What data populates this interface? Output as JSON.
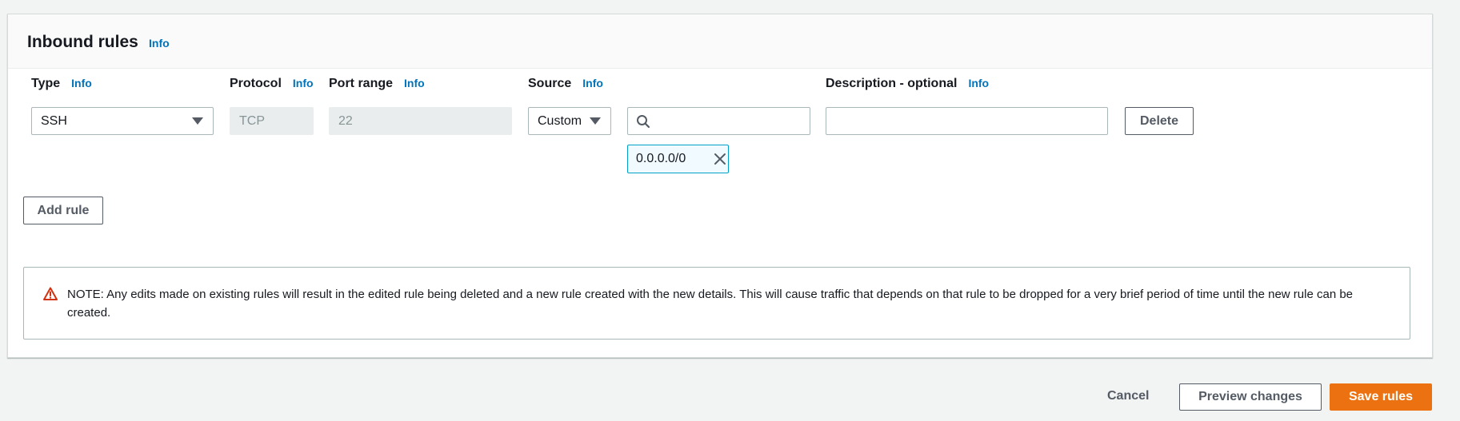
{
  "section": {
    "title": "Inbound rules",
    "info": "Info"
  },
  "columns": {
    "type": {
      "label": "Type",
      "info": "Info"
    },
    "protocol": {
      "label": "Protocol",
      "info": "Info"
    },
    "port_range": {
      "label": "Port range",
      "info": "Info"
    },
    "source": {
      "label": "Source",
      "info": "Info"
    },
    "description": {
      "label": "Description - optional",
      "info": "Info"
    }
  },
  "rule": {
    "type_value": "SSH",
    "protocol_value": "TCP",
    "port_range_value": "22",
    "source_type": "Custom",
    "source_search_value": "",
    "source_token": "0.0.0.0/0",
    "description_value": "",
    "delete_label": "Delete"
  },
  "add_rule_label": "Add rule",
  "note": {
    "text": "NOTE: Any edits made on existing rules will result in the edited rule being deleted and a new rule created with the new details. This will cause traffic that depends on that rule to be dropped for a very brief period of time until the new rule can be created."
  },
  "footer": {
    "cancel_label": "Cancel",
    "preview_label": "Preview changes",
    "save_label": "Save rules"
  },
  "colors": {
    "primary": "#ec7211",
    "link": "#0073bb",
    "warning": "#d13212",
    "token_border": "#00a1c9"
  },
  "icons": {
    "type_dropdown": "chevron-down-icon",
    "source_dropdown": "chevron-down-icon",
    "search": "search-icon",
    "token_remove": "close-icon",
    "note": "warning-icon"
  }
}
